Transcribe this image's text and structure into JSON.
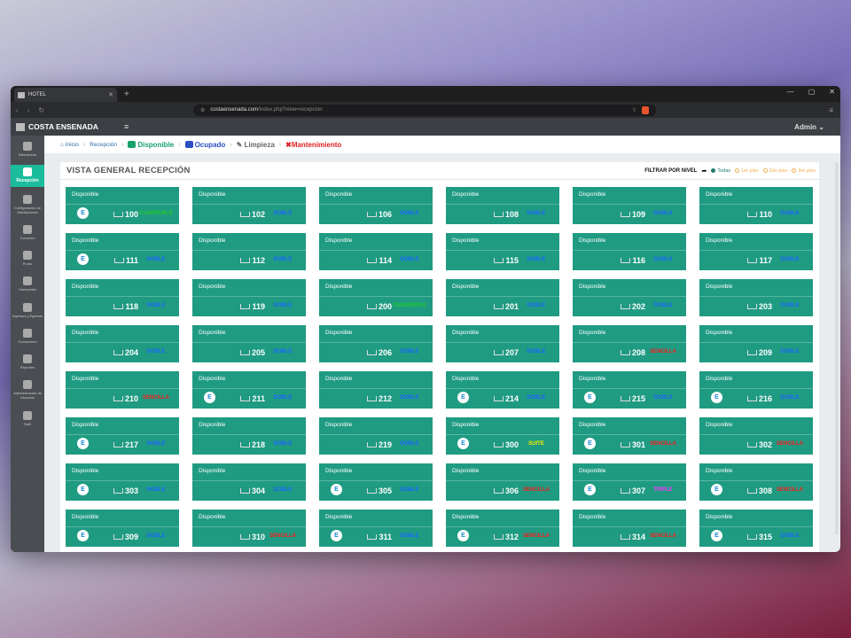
{
  "browser": {
    "tab_title": "HOTEL",
    "url_host": "costaensenada.com",
    "url_path": "/index.php?view=recepcion"
  },
  "app": {
    "brand": "COSTA ENSENADA",
    "user": "Admin"
  },
  "sidebar": {
    "items": [
      {
        "label": "Bienvenida",
        "icon": "calendar-icon",
        "active": false
      },
      {
        "label": "Recepción",
        "icon": "checkin-icon",
        "active": true
      },
      {
        "label": "Configuración de Habitaciones",
        "icon": "bed-icon",
        "active": false
      },
      {
        "label": "Consumo",
        "icon": "key-icon",
        "active": false
      },
      {
        "label": "Punto",
        "icon": "box-icon",
        "active": false
      },
      {
        "label": "Huespedes",
        "icon": "users-icon",
        "active": false
      },
      {
        "label": "Ingresos y Egresos",
        "icon": "chart-icon",
        "active": false
      },
      {
        "label": "Comisiones",
        "icon": "money-icon",
        "active": false
      },
      {
        "label": "Reportes",
        "icon": "report-icon",
        "active": false
      },
      {
        "label": "Administración de Usuarios",
        "icon": "user-icon",
        "active": false
      },
      {
        "label": "Salir",
        "icon": "logout-icon",
        "active": false
      }
    ]
  },
  "breadcrumb": {
    "home": "Inicio",
    "recepcion": "Recepción",
    "disponible": "Disponible",
    "ocupado": "Ocupado",
    "limpieza": "Limpieza",
    "mantenimiento": "Mantenimiento"
  },
  "panel": {
    "title": "VISTA GENERAL RECEPCIÓN",
    "filter_label": "FILTRAR POR NIVEL",
    "filters": [
      "Todas",
      "1er piso",
      "2do piso",
      "3er piso"
    ]
  },
  "colors": {
    "card": "#1f9b82",
    "accent": "#1abc9c"
  },
  "rooms": [
    {
      "status": "Disponible",
      "badge": true,
      "number": "100",
      "type": "CUADRUPLE"
    },
    {
      "status": "Disponible",
      "badge": false,
      "number": "102",
      "type": "DOBLE"
    },
    {
      "status": "Disponible",
      "badge": false,
      "number": "106",
      "type": "DOBLE"
    },
    {
      "status": "Disponible",
      "badge": false,
      "number": "108",
      "type": "DOBLE"
    },
    {
      "status": "Disponible",
      "badge": false,
      "number": "109",
      "type": "DOBLE"
    },
    {
      "status": "Disponible",
      "badge": false,
      "number": "110",
      "type": "DOBLE"
    },
    {
      "status": "Disponible",
      "badge": true,
      "number": "111",
      "type": "DOBLE"
    },
    {
      "status": "Disponible",
      "badge": false,
      "number": "112",
      "type": "DOBLE"
    },
    {
      "status": "Disponible",
      "badge": false,
      "number": "114",
      "type": "DOBLE"
    },
    {
      "status": "Disponible",
      "badge": false,
      "number": "115",
      "type": "DOBLE"
    },
    {
      "status": "Disponible",
      "badge": false,
      "number": "116",
      "type": "DOBLE"
    },
    {
      "status": "Disponible",
      "badge": false,
      "number": "117",
      "type": "DOBLE"
    },
    {
      "status": "Disponible",
      "badge": false,
      "number": "118",
      "type": "DOBLE"
    },
    {
      "status": "Disponible",
      "badge": false,
      "number": "119",
      "type": "DOBLE"
    },
    {
      "status": "Disponible",
      "badge": false,
      "number": "200",
      "type": "CUADRUPLE"
    },
    {
      "status": "Disponible",
      "badge": false,
      "number": "201",
      "type": "DOBLE"
    },
    {
      "status": "Disponible",
      "badge": false,
      "number": "202",
      "type": "DOBLE"
    },
    {
      "status": "Disponible",
      "badge": false,
      "number": "203",
      "type": "DOBLE"
    },
    {
      "status": "Disponible",
      "badge": false,
      "number": "204",
      "type": "DOBLE"
    },
    {
      "status": "Disponible",
      "badge": false,
      "number": "205",
      "type": "DOBLE"
    },
    {
      "status": "Disponible",
      "badge": false,
      "number": "206",
      "type": "DOBLE"
    },
    {
      "status": "Disponible",
      "badge": false,
      "number": "207",
      "type": "DOBLE"
    },
    {
      "status": "Disponible",
      "badge": false,
      "number": "208",
      "type": "SENCILLA"
    },
    {
      "status": "Disponible",
      "badge": false,
      "number": "209",
      "type": "DOBLE"
    },
    {
      "status": "Disponible",
      "badge": false,
      "number": "210",
      "type": "SENCILLA"
    },
    {
      "status": "Disponible",
      "badge": true,
      "number": "211",
      "type": "DOBLE"
    },
    {
      "status": "Disponible",
      "badge": false,
      "number": "212",
      "type": "DOBLE"
    },
    {
      "status": "Disponible",
      "badge": true,
      "number": "214",
      "type": "DOBLE"
    },
    {
      "status": "Disponible",
      "badge": true,
      "number": "215",
      "type": "DOBLE"
    },
    {
      "status": "Disponible",
      "badge": true,
      "number": "216",
      "type": "DOBLE"
    },
    {
      "status": "Disponible",
      "badge": true,
      "number": "217",
      "type": "DOBLE"
    },
    {
      "status": "Disponible",
      "badge": false,
      "number": "218",
      "type": "DOBLE"
    },
    {
      "status": "Disponible",
      "badge": false,
      "number": "219",
      "type": "DOBLE"
    },
    {
      "status": "Disponible",
      "badge": true,
      "number": "300",
      "type": "SUITE"
    },
    {
      "status": "Disponible",
      "badge": true,
      "number": "301",
      "type": "SENCILLA"
    },
    {
      "status": "Disponible",
      "badge": false,
      "number": "302",
      "type": "SENCILLA"
    },
    {
      "status": "Disponible",
      "badge": true,
      "number": "303",
      "type": "DOBLE"
    },
    {
      "status": "Disponible",
      "badge": false,
      "number": "304",
      "type": "DOBLE"
    },
    {
      "status": "Disponible",
      "badge": true,
      "number": "305",
      "type": "DOBLE"
    },
    {
      "status": "Disponible",
      "badge": false,
      "number": "306",
      "type": "SENCILLA"
    },
    {
      "status": "Disponible",
      "badge": true,
      "number": "307",
      "type": "TRIPLE"
    },
    {
      "status": "Disponible",
      "badge": true,
      "number": "308",
      "type": "SENCILLA"
    },
    {
      "status": "Disponible",
      "badge": true,
      "number": "309",
      "type": "DOBLE"
    },
    {
      "status": "Disponible",
      "badge": false,
      "number": "310",
      "type": "SENCILLA"
    },
    {
      "status": "Disponible",
      "badge": true,
      "number": "311",
      "type": "DOBLE"
    },
    {
      "status": "Disponible",
      "badge": true,
      "number": "312",
      "type": "SENCILLA"
    },
    {
      "status": "Disponible",
      "badge": false,
      "number": "314",
      "type": "SENCILLA"
    },
    {
      "status": "Disponible",
      "badge": true,
      "number": "315",
      "type": "DOBLE"
    }
  ],
  "badge_letter": "E"
}
